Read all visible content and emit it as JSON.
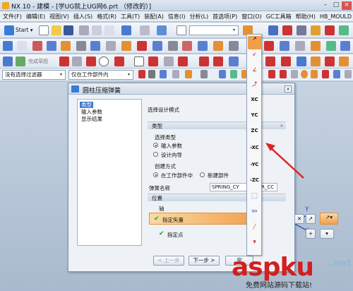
{
  "window": {
    "app_title": "NX 10 - 建模 - [学UG就上UG网6.prt （修改的）]"
  },
  "menubar": {
    "items": [
      "文件(F)",
      "编辑(E)",
      "视图(V)",
      "插入(S)",
      "格式(R)",
      "工具(T)",
      "装配(A)",
      "信息(I)",
      "分析(L)",
      "首选项(P)",
      "窗口(O)",
      "GC工具箱",
      "帮助(H)",
      "HB_MOULD"
    ]
  },
  "toolbar": {
    "start_label": "Start ▾",
    "finish_sketch_label": "完成草图"
  },
  "filter": {
    "selection_filter": "没有选择过滤器",
    "scope": "仅在工作部件内"
  },
  "dialog": {
    "title": "圆柱压缩弹簧",
    "close_label": "x",
    "tree": [
      "类型",
      "输入参数",
      "显示结果"
    ],
    "select_design_mode_label": "选择设计模式",
    "type_group": {
      "header": "类型",
      "select_type_label": "选择类型",
      "options": [
        "输入参数",
        "设计向导"
      ],
      "create_mode_label": "创建方式",
      "create_options": [
        "在工作部件中",
        "新建部件"
      ]
    },
    "spring_name_label": "弹簧名称",
    "spring_name_value": "SPRING_CY",
    "spring_name_suffix": "R_CC",
    "position_group": {
      "header": "位置",
      "axis_label": "轴",
      "specify_vector_label": "指定矢量",
      "specify_point_label": "指定点"
    },
    "buttons": {
      "prev": "< 上一步",
      "next": "下一步 >",
      "finish": "完"
    },
    "chevron": "»"
  },
  "vector_popup": {
    "items": [
      "auto-vector",
      "two-points",
      "angle-vector",
      "curve-vector",
      "XC",
      "YC",
      "ZC",
      "-XC",
      "-YC",
      "-ZC",
      "view-direction",
      "coord-system",
      "ratio",
      "dropdown"
    ]
  },
  "axis_labels": {
    "y": "Y",
    "x": "X"
  },
  "watermark": {
    "main": "aspku",
    "net": ".net",
    "sub": "免费网站源码下载站!"
  }
}
